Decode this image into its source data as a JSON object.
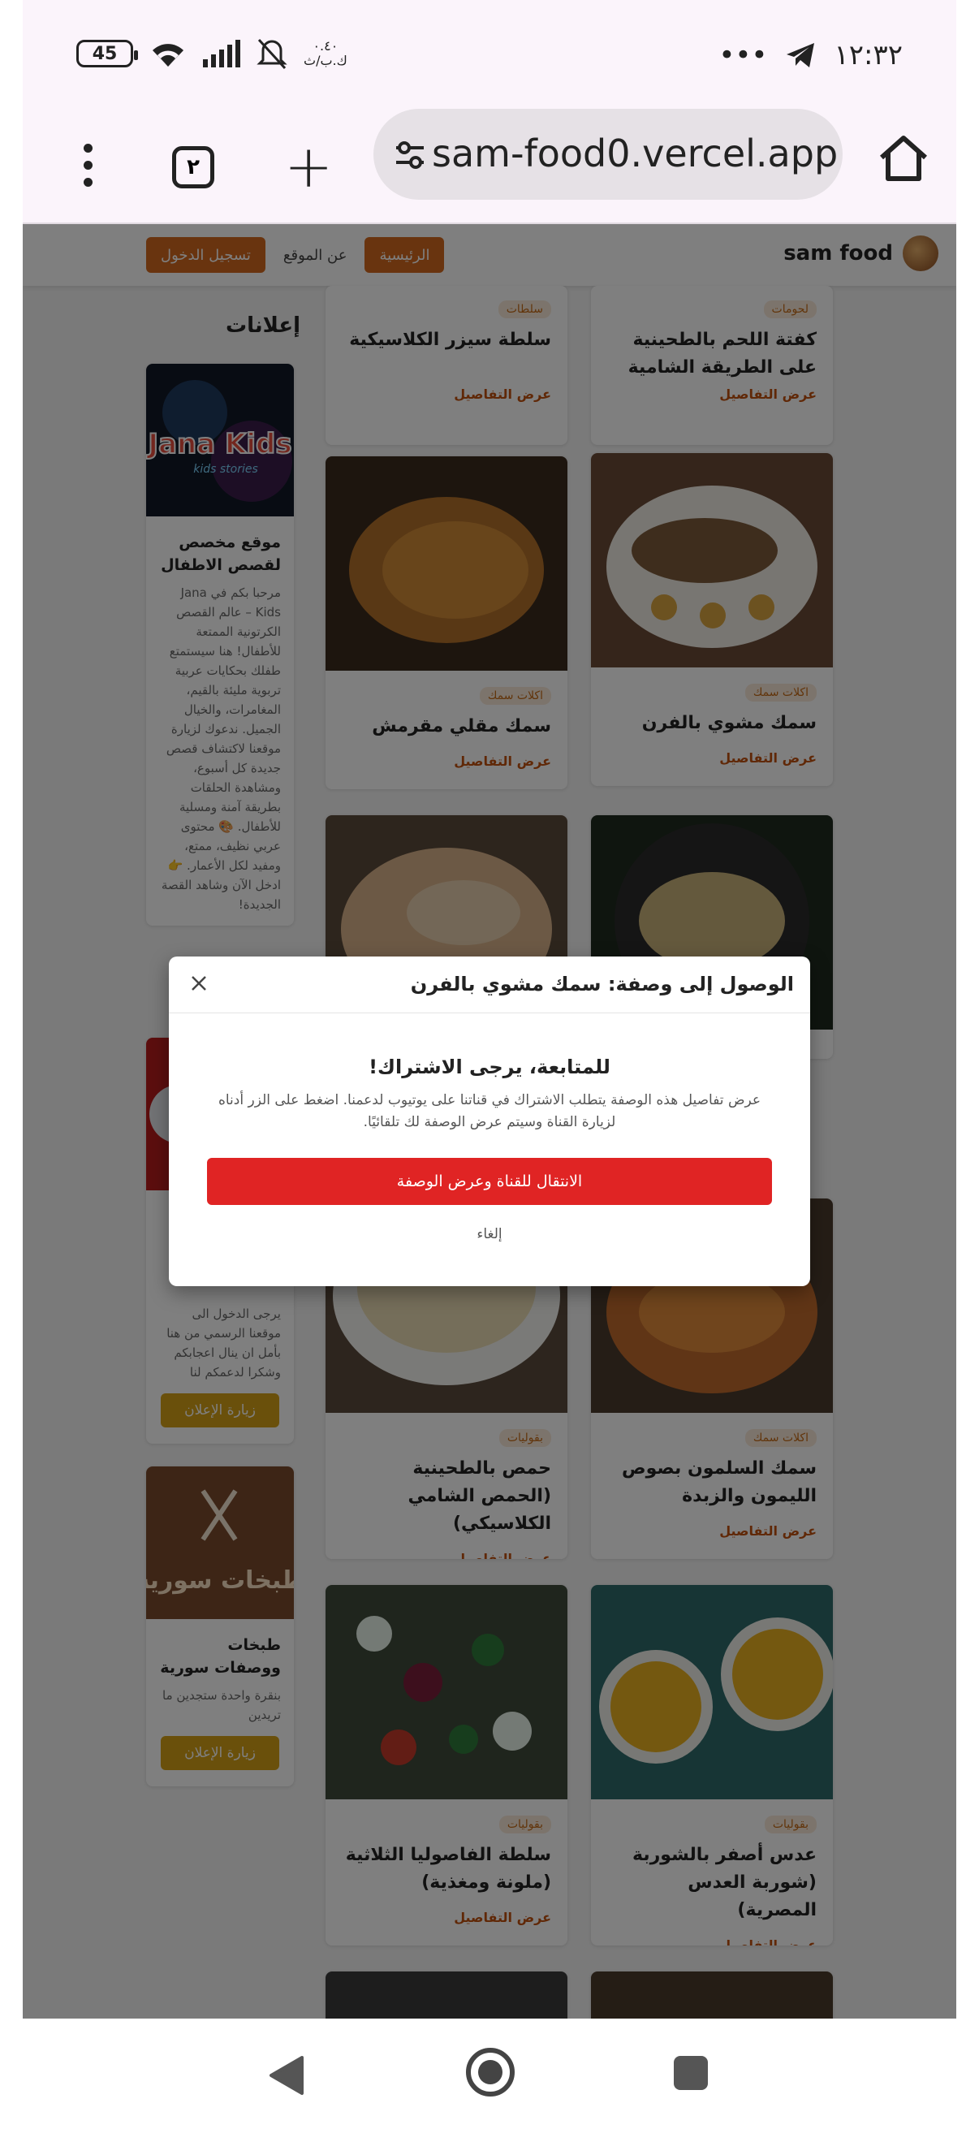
{
  "status_bar": {
    "time": "١٢:٣٢",
    "battery": "45",
    "speed_value": "٠.٤٠",
    "speed_unit": "ك.ب/ث",
    "more": "•••"
  },
  "browser": {
    "url": "sam-food0.vercel.app",
    "tab_count": "٢"
  },
  "site": {
    "brand": "sam food",
    "nav": {
      "home": "الرئيسية",
      "about": "عن الموقع",
      "login": "تسجيل الدخول"
    }
  },
  "recipes": [
    {
      "tag": "سلطات",
      "title": "سلطة سيزر الكلاسيكية",
      "more": "عرض التفاصيل"
    },
    {
      "tag": "لحومات",
      "title": "كفتة اللحم بالطحينية على الطريقة الشامية",
      "more": "عرض التفاصيل"
    },
    {
      "tag": "اكلات سمك",
      "title": "سمك مقلي مقرمش",
      "more": "عرض التفاصيل"
    },
    {
      "tag": "اكلات سمك",
      "title": "سمك مشوي بالفرن",
      "more": "عرض التفاصيل"
    },
    {
      "tag": "بقوليات",
      "title": "حمص بالطحينية (الحمص الشامي الكلاسيكي)",
      "more": "عرض التفاصيل"
    },
    {
      "tag": "اكلات سمك",
      "title": "سمك السلمون بصوص الليمون والزبدة",
      "more": "عرض التفاصيل"
    },
    {
      "tag": "بقوليات",
      "title": "سلطة الفاصوليا الثلاثية (ملونة ومغذية)",
      "more": "عرض التفاصيل"
    },
    {
      "tag": "بقوليات",
      "title": "عدس أصفر بالشوربة (شوربة العدس المصرية)",
      "more": "عرض التفاصيل"
    }
  ],
  "ads": {
    "title": "إعلانات",
    "items": [
      {
        "image_text": "Jana Kids",
        "image_subtext": "kids stories",
        "title": "موقع مخصص لقصص الاطفال",
        "text": "مرحبا بكم في Jana Kids – عالم القصص الكرتونية الممتعة للأطفال! هنا سيستمتع طفلك بحكايات عربية تربوية مليئة بالقيم، المغامرات، والخيال الجميل. ندعوك لزيارة موقعنا لاكتشاف قصص جديدة كل أسبوع، ومشاهدة الحلقات بطريقة آمنة ومسلية للأطفال. 🎨 محتوى عربي نظيف، ممتع، ومفيد لكل الأعمار. 👉 ادخل الآن وشاهد القصة الجديدة!",
        "button": ""
      },
      {
        "title": "",
        "text": "يرجى الدخول الى موقعنا الرسمي من هنا بأمل ان ينال اعجابكم وشكرا لدعمكم لنا",
        "button": "زيارة الإعلان"
      },
      {
        "image_text": "طبخات سورية",
        "title": "طبخات ووصفات سورية",
        "text": "بنقرة واحدة ستجدين ما تريدين",
        "button": "زيارة الإعلان"
      }
    ]
  },
  "modal": {
    "title": "الوصول إلى وصفة: سمك مشوي بالفرن",
    "subtitle": "للمتابعة، يرجى الاشتراك!",
    "text": "عرض تفاصيل هذه الوصفة يتطلب الاشتراك في قناتنا على يوتيوب لدعمنا. اضغط على الزر أدناه لزيارة القناة وسيتم عرض الوصفة لك تلقائيًا.",
    "cta": "الانتقال للقناة وعرض الوصفة",
    "cancel": "إلغاء"
  },
  "colors": {
    "accent": "#d2691e",
    "cta": "#e02424",
    "ad_button": "#d4a017"
  }
}
